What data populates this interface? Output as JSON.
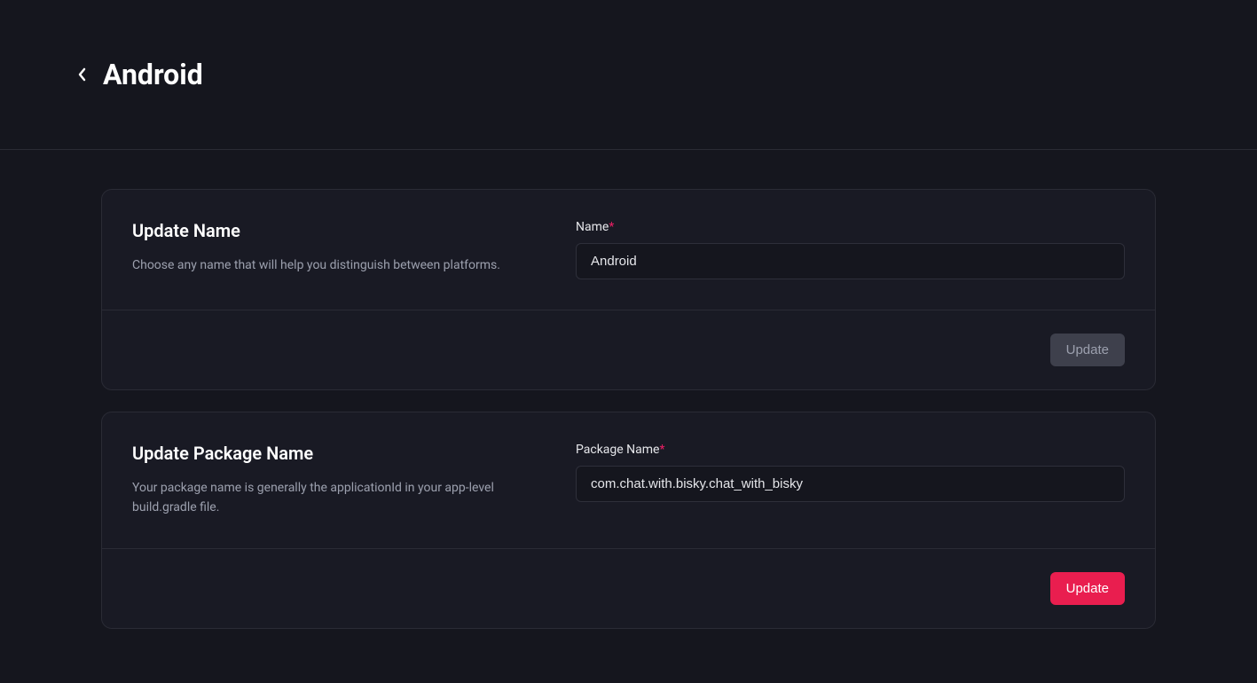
{
  "header": {
    "title": "Android"
  },
  "sections": {
    "name": {
      "title": "Update Name",
      "description": "Choose any name that will help you distinguish between platforms.",
      "fieldLabel": "Name",
      "value": "Android",
      "buttonLabel": "Update"
    },
    "package": {
      "title": "Update Package Name",
      "description": "Your package name is generally the applicationId in your app-level build.gradle file.",
      "fieldLabel": "Package Name",
      "value": "com.chat.with.bisky.chat_with_bisky",
      "buttonLabel": "Update"
    }
  }
}
